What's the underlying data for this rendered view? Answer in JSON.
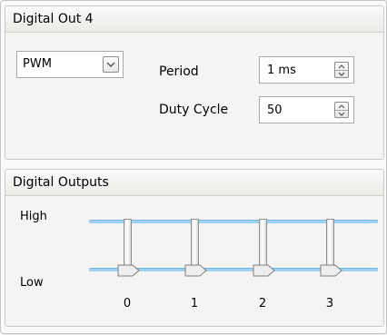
{
  "top_panel": {
    "title": "Digital Out 4",
    "mode": {
      "selected": "PWM"
    },
    "period": {
      "label": "Period",
      "value": "1 ms"
    },
    "duty_cycle": {
      "label": "Duty Cycle",
      "value": "50"
    }
  },
  "bottom_panel": {
    "title": "Digital Outputs",
    "high_label": "High",
    "low_label": "Low",
    "channels": [
      {
        "label": "0",
        "state": "Low"
      },
      {
        "label": "1",
        "state": "Low"
      },
      {
        "label": "2",
        "state": "Low"
      },
      {
        "label": "3",
        "state": "Low"
      }
    ]
  },
  "colors": {
    "level_line": "#9fd1f2",
    "panel_bg": "#f5f4f2"
  }
}
